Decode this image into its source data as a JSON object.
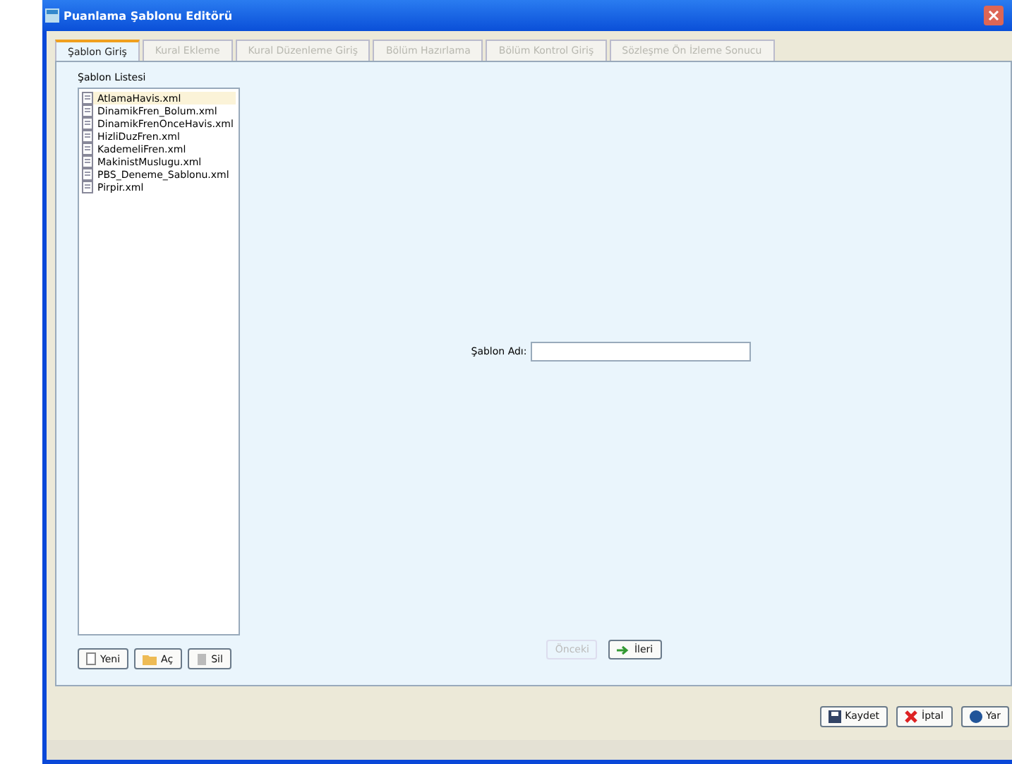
{
  "window": {
    "title": "Puanlama Şablonu Editörü"
  },
  "tabs": [
    {
      "label": "Şablon Giriş",
      "selected": true,
      "disabled": false
    },
    {
      "label": "Kural Ekleme",
      "selected": false,
      "disabled": true
    },
    {
      "label": "Kural Düzenleme Giriş",
      "selected": false,
      "disabled": true
    },
    {
      "label": "Bölüm Hazırlama",
      "selected": false,
      "disabled": true
    },
    {
      "label": "Bölüm Kontrol Giriş",
      "selected": false,
      "disabled": true
    },
    {
      "label": "Sözleşme Ön İzleme Sonucu",
      "selected": false,
      "disabled": true
    }
  ],
  "template_list": {
    "label": "Şablon Listesi",
    "items": [
      {
        "name": "AtlamaHavis.xml",
        "selected": true
      },
      {
        "name": "DinamikFren_Bolum.xml",
        "selected": false
      },
      {
        "name": "DinamikFrenOnceHavis.xml",
        "selected": false
      },
      {
        "name": "HizliDuzFren.xml",
        "selected": false
      },
      {
        "name": "KademeliFren.xml",
        "selected": false
      },
      {
        "name": "MakinistMuslugu.xml",
        "selected": false
      },
      {
        "name": "PBS_Deneme_Sablonu.xml",
        "selected": false
      },
      {
        "name": "Pirpir.xml",
        "selected": false
      }
    ],
    "buttons": [
      {
        "label": "Yeni",
        "kind": "new"
      },
      {
        "label": "Aç",
        "kind": "open"
      },
      {
        "label": "Sil",
        "kind": "delete"
      }
    ]
  },
  "template_name": {
    "label": "Şablon Adı:"
  },
  "nav_buttons": [
    {
      "label": "Önceki",
      "disabled": true,
      "kind": "prev"
    },
    {
      "label": "İleri",
      "disabled": false,
      "kind": "next"
    }
  ],
  "footer_buttons": [
    {
      "label": "Kaydet",
      "kind": "save"
    },
    {
      "label": "İptal",
      "kind": "cancel"
    },
    {
      "label": "Yar",
      "kind": "help"
    }
  ]
}
